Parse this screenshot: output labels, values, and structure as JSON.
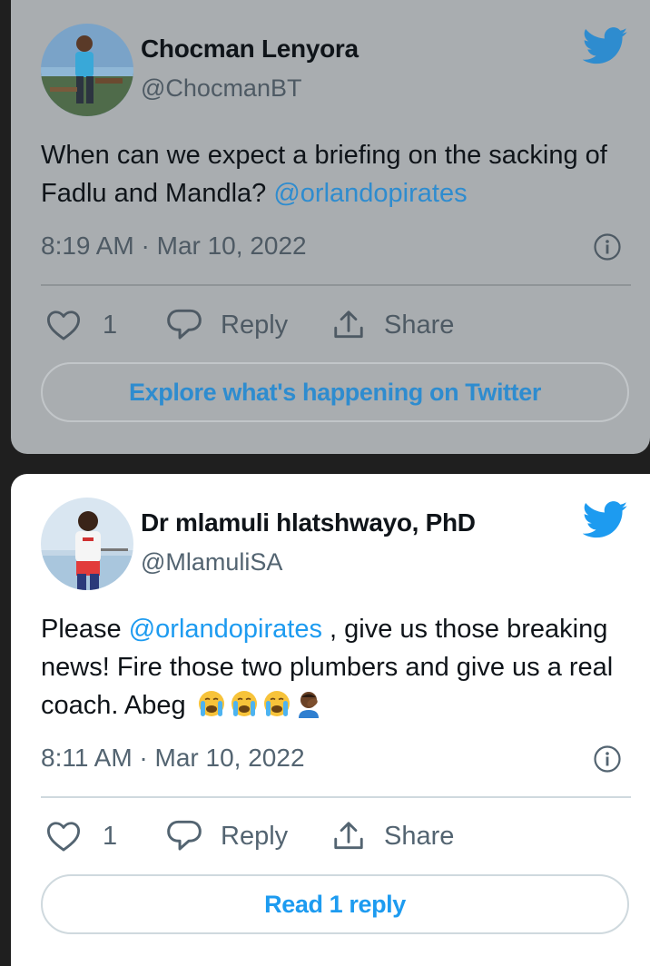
{
  "tweets": [
    {
      "name": "Chocman Lenyora",
      "handle": "@ChocmanBT",
      "text_before": "When can we expect a briefing on the sacking of Fadlu and Mandla? ",
      "mention": "@orlandopirates",
      "text_after": "",
      "emojis": [],
      "timestamp": "8:19 AM · Mar 10, 2022",
      "likes": "1",
      "reply_label": "Reply",
      "share_label": "Share",
      "cta_label": "Explore what's happening on Twitter"
    },
    {
      "name": "Dr mlamuli hlatshwayo, PhD",
      "handle": "@MlamuliSA",
      "text_before": "Please ",
      "mention": "@orlandopirates",
      "text_after": " , give us those breaking news! Fire those two plumbers and give us a real coach. Abeg",
      "emojis": [
        "loudly-crying-face",
        "loudly-crying-face",
        "loudly-crying-face",
        "man-facepalming"
      ],
      "timestamp": "8:11 AM · Mar 10, 2022",
      "likes": "1",
      "reply_label": "Reply",
      "share_label": "Share",
      "cta_label": "Read 1 reply"
    }
  ],
  "colors": {
    "accent": "#1d9bf0",
    "dimmed_card": "#a9adb0",
    "background": "#1f1f1f"
  },
  "icons": [
    "twitter-bird-icon",
    "heart-icon",
    "reply-bubble-icon",
    "share-icon",
    "info-icon"
  ]
}
